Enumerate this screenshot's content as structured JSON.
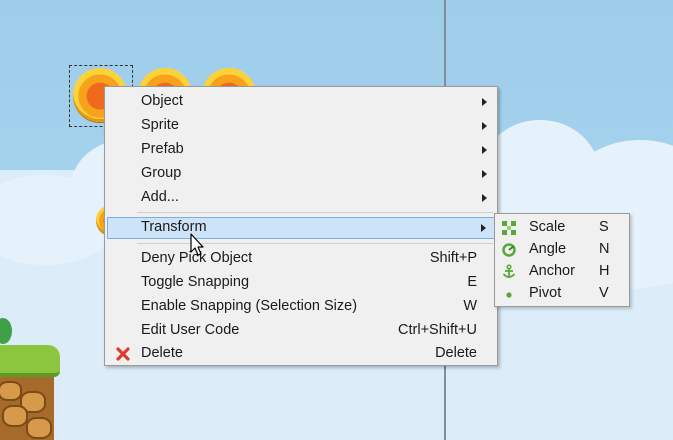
{
  "context_menu": {
    "items": [
      {
        "label": "Object",
        "submenu": true
      },
      {
        "label": "Sprite",
        "submenu": true
      },
      {
        "label": "Prefab",
        "submenu": true
      },
      {
        "label": "Group",
        "submenu": true
      },
      {
        "label": "Add...",
        "submenu": true
      },
      {
        "label": "Transform",
        "submenu": true,
        "highlighted": true
      },
      {
        "label": "Deny Pick Object",
        "shortcut": "Shift+P"
      },
      {
        "label": "Toggle Snapping",
        "shortcut": "E"
      },
      {
        "label": "Enable Snapping (Selection Size)",
        "shortcut": "W"
      },
      {
        "label": "Edit User Code",
        "shortcut": "Ctrl+Shift+U"
      },
      {
        "label": "Delete",
        "shortcut": "Delete",
        "icon": "delete-x-icon"
      }
    ]
  },
  "transform_submenu": {
    "items": [
      {
        "label": "Scale",
        "shortcut": "S",
        "icon": "scale-icon"
      },
      {
        "label": "Angle",
        "shortcut": "N",
        "icon": "angle-icon"
      },
      {
        "label": "Anchor",
        "shortcut": "H",
        "icon": "anchor-icon"
      },
      {
        "label": "Pivot",
        "shortcut": "V",
        "icon": "pivot-icon"
      }
    ]
  },
  "colors": {
    "highlight": "#cde3f7",
    "menu_bg": "#f0f0f0",
    "delete_icon": "#e03a2e",
    "submenu_icon": "#5aa63a"
  }
}
